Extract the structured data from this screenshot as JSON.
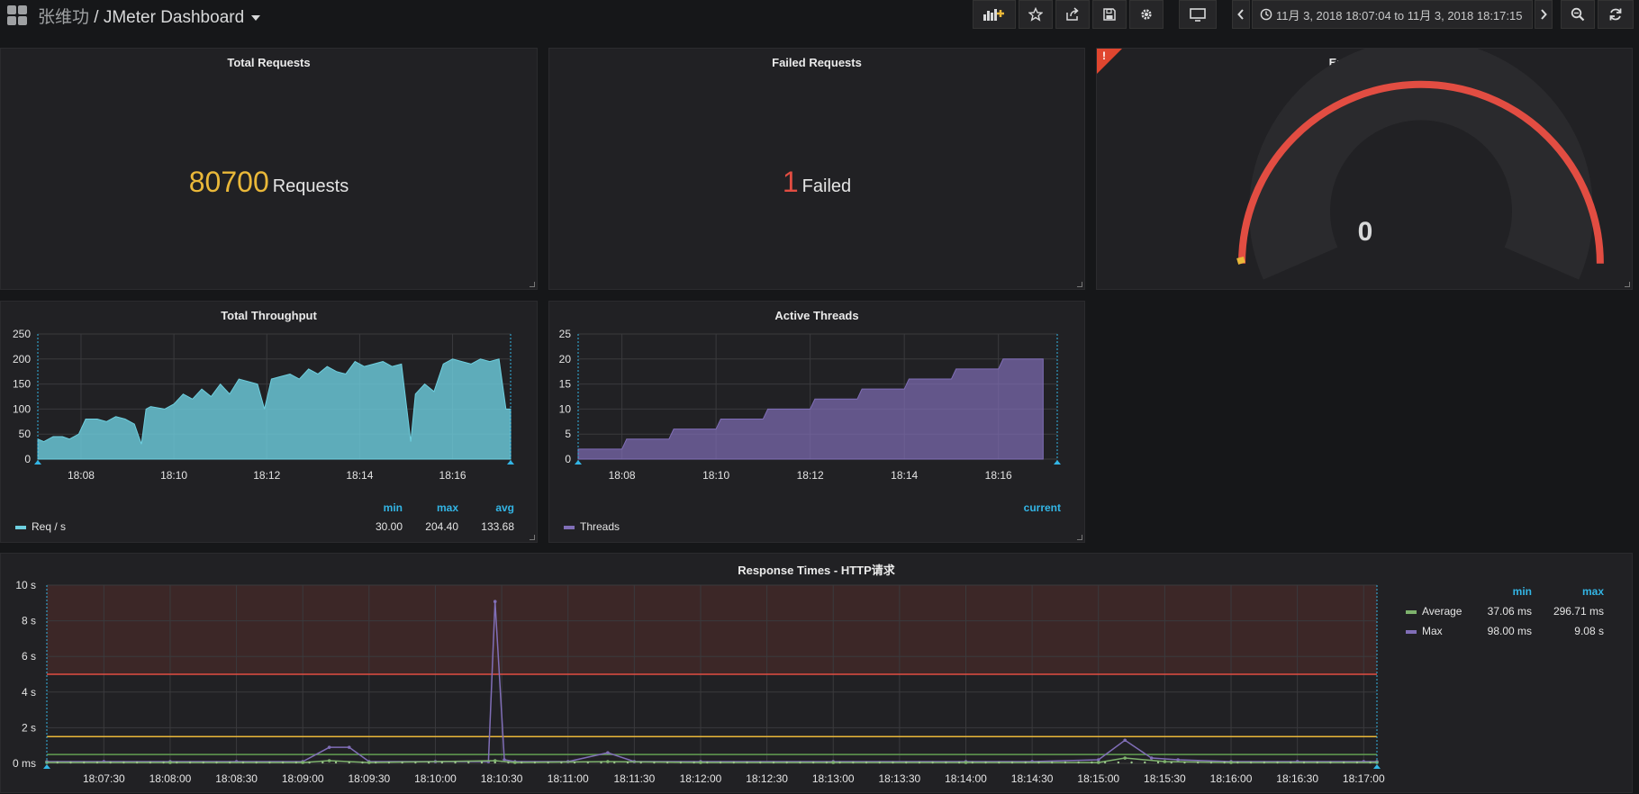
{
  "header": {
    "folder": "张维功",
    "separator": " / ",
    "title": "JMeter Dashboard",
    "time_range": "11月 3, 2018 18:07:04 to 11月 3, 2018 18:17:15",
    "buttons": [
      "add-panel-icon",
      "star-icon",
      "share-icon",
      "save-icon",
      "gear-icon",
      "tv-icon",
      "chevron-left-icon",
      "clock-icon",
      "chevron-right-icon",
      "zoom-out-icon",
      "refresh-icon"
    ]
  },
  "panels": {
    "total_requests": {
      "title": "Total Requests",
      "value": "80700",
      "unit": "Requests",
      "color": "#eab839"
    },
    "failed_requests": {
      "title": "Failed Requests",
      "value": "1",
      "unit": "Failed",
      "color": "#e24d42"
    },
    "error_rate": {
      "title": "Error Rate %",
      "value": "0",
      "alert_mark": "!",
      "gauge_color": "#e24d42"
    },
    "throughput": {
      "title": "Total Throughput",
      "legend": {
        "series": "Req / s",
        "headers": [
          "min",
          "max",
          "avg"
        ],
        "values": [
          "30.00",
          "204.40",
          "133.68"
        ],
        "color": "#6ed0e0"
      }
    },
    "threads": {
      "title": "Active Threads",
      "legend": {
        "series": "Threads",
        "headers": [
          "current"
        ],
        "values": [
          ""
        ],
        "color": "#806eb7"
      }
    },
    "response_times": {
      "title": "Response Times - HTTP请求",
      "legend": {
        "headers": [
          "min",
          "max"
        ],
        "series": [
          {
            "name": "Average",
            "values": [
              "37.06 ms",
              "296.71 ms"
            ],
            "color": "#7eb26d"
          },
          {
            "name": "Max",
            "values": [
              "98.00 ms",
              "9.08 s"
            ],
            "color": "#806eb7"
          }
        ]
      }
    }
  },
  "chart_data": [
    {
      "type": "area",
      "title": "Total Throughput",
      "ylim": [
        0,
        250
      ],
      "yticks": [
        "250",
        "200",
        "150",
        "100",
        "50",
        "0"
      ],
      "xticks": [
        "18:08",
        "18:10",
        "18:12",
        "18:14",
        "18:16"
      ],
      "xlim_minutes": [
        7.07,
        17.25
      ],
      "series": [
        {
          "name": "Req / s",
          "color": "#6ed0e0",
          "x": [
            7.07,
            7.2,
            7.4,
            7.6,
            7.75,
            7.95,
            8.1,
            8.35,
            8.55,
            8.75,
            8.95,
            9.15,
            9.3,
            9.4,
            9.5,
            9.8,
            10.0,
            10.2,
            10.4,
            10.6,
            10.8,
            11.0,
            11.2,
            11.4,
            11.6,
            11.8,
            11.95,
            12.1,
            12.3,
            12.5,
            12.7,
            12.9,
            13.1,
            13.3,
            13.5,
            13.7,
            13.9,
            14.1,
            14.3,
            14.5,
            14.7,
            14.9,
            15.1,
            15.2,
            15.4,
            15.6,
            15.8,
            16.0,
            16.2,
            16.4,
            16.6,
            16.8,
            17.0,
            17.15,
            17.25
          ],
          "y": [
            40,
            35,
            45,
            45,
            40,
            50,
            80,
            80,
            75,
            85,
            80,
            70,
            30,
            100,
            105,
            100,
            110,
            130,
            120,
            140,
            125,
            150,
            130,
            160,
            155,
            150,
            100,
            160,
            165,
            170,
            160,
            180,
            170,
            185,
            175,
            170,
            195,
            185,
            190,
            195,
            185,
            190,
            35,
            130,
            150,
            135,
            190,
            200,
            195,
            190,
            200,
            195,
            200,
            100,
            100
          ]
        }
      ]
    },
    {
      "type": "area",
      "title": "Active Threads",
      "ylim": [
        0,
        25
      ],
      "yticks": [
        "25",
        "20",
        "15",
        "10",
        "5",
        "0"
      ],
      "xticks": [
        "18:08",
        "18:10",
        "18:12",
        "18:14",
        "18:16"
      ],
      "xlim_minutes": [
        7.07,
        17.25
      ],
      "series": [
        {
          "name": "Threads",
          "color": "#806eb7",
          "steps": [
            [
              7.07,
              2
            ],
            [
              8.0,
              2
            ],
            [
              8.1,
              4
            ],
            [
              9.0,
              4
            ],
            [
              9.1,
              6
            ],
            [
              10.0,
              6
            ],
            [
              10.1,
              8
            ],
            [
              11.0,
              8
            ],
            [
              11.1,
              10
            ],
            [
              12.0,
              10
            ],
            [
              12.1,
              12
            ],
            [
              13.0,
              12
            ],
            [
              13.1,
              14
            ],
            [
              14.0,
              14
            ],
            [
              14.1,
              16
            ],
            [
              15.0,
              16
            ],
            [
              15.1,
              18
            ],
            [
              16.0,
              18
            ],
            [
              16.1,
              20
            ],
            [
              16.95,
              20
            ]
          ]
        }
      ]
    },
    {
      "type": "line",
      "title": "Response Times - HTTP请求",
      "ylim_seconds": [
        0,
        10
      ],
      "yticks": [
        "10 s",
        "8 s",
        "6 s",
        "4 s",
        "2 s",
        "0 ms"
      ],
      "xticks": [
        "18:07:30",
        "18:08:00",
        "18:08:30",
        "18:09:00",
        "18:09:30",
        "18:10:00",
        "18:10:30",
        "18:11:00",
        "18:11:30",
        "18:12:00",
        "18:12:30",
        "18:13:00",
        "18:13:30",
        "18:14:00",
        "18:14:30",
        "18:15:00",
        "18:15:30",
        "18:16:00",
        "18:16:30",
        "18:17:00"
      ],
      "thresholds_seconds": [
        {
          "value": 5.0,
          "color": "#e24d42"
        },
        {
          "value": 1.5,
          "color": "#eab839"
        },
        {
          "value": 0.5,
          "color": "#629e51"
        }
      ],
      "series": [
        {
          "name": "Max",
          "color": "#806eb7",
          "x": [
            7.07,
            7.5,
            8.0,
            8.5,
            9.0,
            9.2,
            9.35,
            9.5,
            10.0,
            10.4,
            10.45,
            10.52,
            10.6,
            11.0,
            11.3,
            11.5,
            12.0,
            13.0,
            14.0,
            14.5,
            15.0,
            15.2,
            15.4,
            15.6,
            16.0,
            16.5,
            17.0,
            17.1
          ],
          "y": [
            0.1,
            0.1,
            0.1,
            0.1,
            0.1,
            0.9,
            0.9,
            0.1,
            0.1,
            0.1,
            9.08,
            0.2,
            0.1,
            0.1,
            0.6,
            0.1,
            0.1,
            0.1,
            0.1,
            0.1,
            0.2,
            1.3,
            0.3,
            0.2,
            0.1,
            0.1,
            0.1,
            0.1
          ]
        },
        {
          "name": "Average",
          "color": "#7eb26d",
          "x": [
            7.07,
            8.0,
            9.0,
            9.2,
            9.5,
            10.45,
            10.6,
            11.3,
            12.0,
            13.0,
            14.0,
            15.0,
            15.2,
            15.5,
            16.0,
            17.1
          ],
          "y": [
            0.05,
            0.05,
            0.05,
            0.15,
            0.05,
            0.15,
            0.05,
            0.1,
            0.05,
            0.05,
            0.05,
            0.05,
            0.3,
            0.1,
            0.05,
            0.05
          ]
        }
      ]
    }
  ]
}
